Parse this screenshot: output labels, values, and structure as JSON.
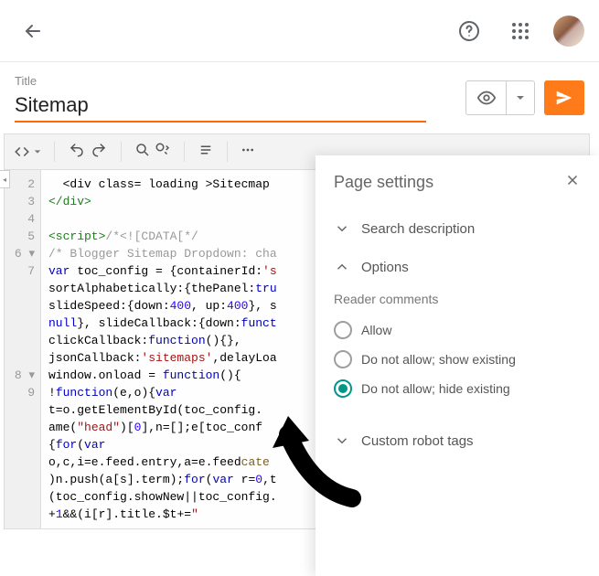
{
  "header": {
    "help_icon": "help",
    "apps_icon": "apps"
  },
  "title": {
    "label": "Title",
    "value": "Sitemap"
  },
  "panel": {
    "heading": "Page settings",
    "search_desc": "Search description",
    "options": "Options",
    "reader_comments_label": "Reader comments",
    "radio_allow": "Allow",
    "radio_noshow": "Do not allow; show existing",
    "radio_nohide": "Do not allow; hide existing",
    "custom_robot": "Custom robot tags"
  },
  "gutter": [
    "2",
    "3",
    "4",
    "5",
    "6 ▾",
    "7",
    "",
    "",
    "",
    "",
    "",
    "8 ▾",
    "9",
    "",
    "",
    "",
    "",
    "",
    "",
    ""
  ],
  "code_lines": [
    {
      "html": "  &lt;div class= loading &gt;Sitecmap"
    },
    {
      "html": "<span class='t-tag'>&lt;/div&gt;</span>"
    },
    {
      "html": ""
    },
    {
      "html": "<span class='t-tag'>&lt;script&gt;</span><span class='t-com'>/*&lt;![CDATA[*/</span>"
    },
    {
      "html": "<span class='t-com'>/* Blogger Sitemap Dropdown: cha</span>"
    },
    {
      "html": "<span class='t-kw'>var</span> toc_config = {containerId:<span class='t-str'>'s</span>"
    },
    {
      "html": "sortAlphabetically:{thePanel:<span class='t-kw'>tru</span>"
    },
    {
      "html": "slideSpeed:{down:<span class='t-num'>400</span>, up:<span class='t-num'>400</span>}, s"
    },
    {
      "html": "<span class='t-kw'>null</span>}, slideCallback:{down:<span class='t-kw'>funct</span>"
    },
    {
      "html": "clickCallback:<span class='t-kw'>function</span>(){},"
    },
    {
      "html": "jsonCallback:<span class='t-str'>'sitemaps'</span>,delayLoa"
    },
    {
      "html": "window.onload = <span class='t-kw'>function</span>(){"
    },
    {
      "html": "!<span class='t-kw'>function</span>(e,o){<span class='t-kw'>var</span>"
    },
    {
      "html": "t=o.getElementById(toc_config."
    },
    {
      "html": "ame(<span class='t-str'>\"head\"</span>)[<span class='t-num'>0</span>],n=[];e[toc_conf"
    },
    {
      "html": "{<span class='t-kw'>for</span>(<span class='t-kw'>var</span>"
    },
    {
      "html": "o,c,i=e.feed.entry,a=e.feed<span class='t-prop'>cate</span>"
    },
    {
      "html": ")n.push(a[s].term);<span class='t-kw'>for</span>(<span class='t-kw'>var</span> r=<span class='t-num'>0</span>,t"
    },
    {
      "html": "(toc_config.showNew||toc_config."
    },
    {
      "html": "+<span class='t-num'>1</span>&amp;&amp;(i[r].title.$t+=<span class='t-str'>\"</span>"
    }
  ]
}
